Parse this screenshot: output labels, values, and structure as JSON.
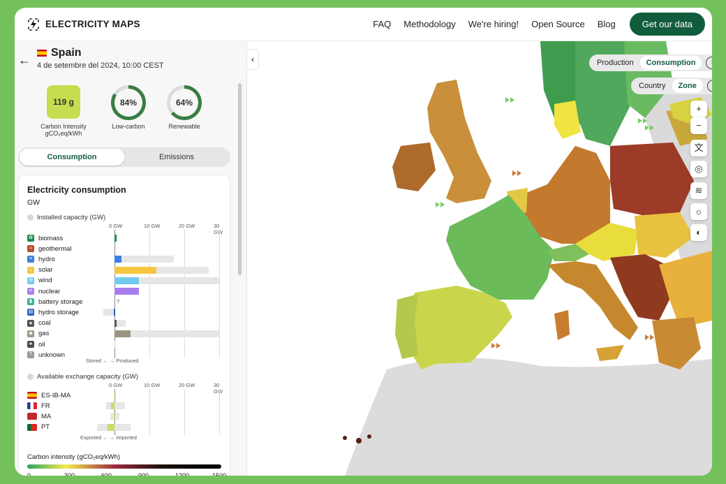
{
  "app": {
    "logo_text": "ELECTRICITY MAPS",
    "nav": [
      "FAQ",
      "Methodology",
      "We're hiring!",
      "Open Source",
      "Blog"
    ],
    "cta": "Get our data"
  },
  "zone": {
    "name": "Spain",
    "date": "4 de setembre del 2024, 10:00 CEST",
    "carbon_intensity": "119 g",
    "carbon_intensity_label": "Carbon Intensity",
    "carbon_intensity_unit": "gCO₂eq/kWh",
    "low_carbon": "84%",
    "low_carbon_label": "Low-carbon",
    "low_carbon_value": 0.84,
    "renewable": "64%",
    "renewable_label": "Renewable",
    "renewable_value": 0.64
  },
  "tabs": {
    "consumption": "Consumption",
    "emissions": "Emissions"
  },
  "card": {
    "title": "Electricity consumption",
    "unit": "GW",
    "installed_label": "Installed capacity (GW)",
    "exchange_label": "Available exchange capacity (GW)",
    "axis_ticks": [
      "0 GW",
      "10 GW",
      "20 GW",
      "30 GW"
    ],
    "stored_produced": "Stored ← → Produced",
    "exported_imported": "Exported ← → Imported",
    "unknown_mark": "?",
    "sources": [
      {
        "label": "biomass",
        "color": "#1e8a4c",
        "icon": "leaf-icon",
        "value": 0.5,
        "capacity": 0.5
      },
      {
        "label": "geothermal",
        "color": "#b5502b",
        "icon": "geothermal-icon",
        "value": 0,
        "capacity": 0
      },
      {
        "label": "hydro",
        "color": "#3b7fe0",
        "icon": "hydro-icon",
        "value": 2,
        "capacity": 17
      },
      {
        "label": "solar",
        "color": "#f5c740",
        "icon": "sun-icon",
        "value": 12,
        "capacity": 27
      },
      {
        "label": "wind",
        "color": "#74c9f0",
        "icon": "wind-icon",
        "value": 7,
        "capacity": 30
      },
      {
        "label": "nuclear",
        "color": "#a97ef0",
        "icon": "atom-icon",
        "value": 7,
        "capacity": 7
      },
      {
        "label": "battery storage",
        "color": "#39b39a",
        "icon": "battery-icon",
        "value": null,
        "capacity": 0
      },
      {
        "label": "hydro storage",
        "color": "#2a5fc4",
        "icon": "hydro-storage-icon",
        "value": -0.3,
        "capacity": 3.3,
        "neg_capacity": 3.3
      },
      {
        "label": "coal",
        "color": "#555555",
        "icon": "coal-icon",
        "value": 0.6,
        "capacity": 3.2
      },
      {
        "label": "gas",
        "color": "#9c9482",
        "icon": "gas-icon",
        "value": 4.5,
        "capacity": 30
      },
      {
        "label": "oil",
        "color": "#5a4b44",
        "icon": "oil-icon",
        "value": 0,
        "capacity": 0.3
      },
      {
        "label": "unknown",
        "color": "#9a9a9a",
        "icon": "question-icon",
        "value": 0,
        "capacity": 0
      }
    ],
    "exchanges": [
      {
        "label": "ES-IB-MA",
        "flag": "es",
        "value": 0.2,
        "neg": 0.2,
        "pos": 0.3
      },
      {
        "label": "FR",
        "flag": "fr",
        "value": -1,
        "neg": 2.5,
        "pos": 3
      },
      {
        "label": "MA",
        "flag": "ma",
        "value": -0.3,
        "neg": 1.2,
        "pos": 1.3
      },
      {
        "label": "PT",
        "flag": "pt",
        "value": -2,
        "neg": 5,
        "pos": 4.5
      }
    ],
    "legend_title": "Carbon intensity (gCO₂eq/kWh)",
    "legend_ticks": [
      "0",
      "300",
      "600",
      "900",
      "1200",
      "1500"
    ]
  },
  "map_controls": {
    "production": "Production",
    "consumption": "Consumption",
    "country": "Country",
    "zone": "Zone",
    "tools": [
      {
        "name": "zoom-in-button",
        "glyph": "+"
      },
      {
        "name": "zoom-out-button",
        "glyph": "−"
      },
      {
        "name": "language-button",
        "glyph": "文"
      },
      {
        "name": "hide-layer-button",
        "glyph": "◎"
      },
      {
        "name": "wind-layer-button",
        "glyph": "≋"
      },
      {
        "name": "solar-layer-button",
        "glyph": "☼"
      },
      {
        "name": "theme-button",
        "glyph": "◐"
      }
    ]
  },
  "colors": {
    "brand": "#125c3e",
    "background": "#74c15c"
  }
}
